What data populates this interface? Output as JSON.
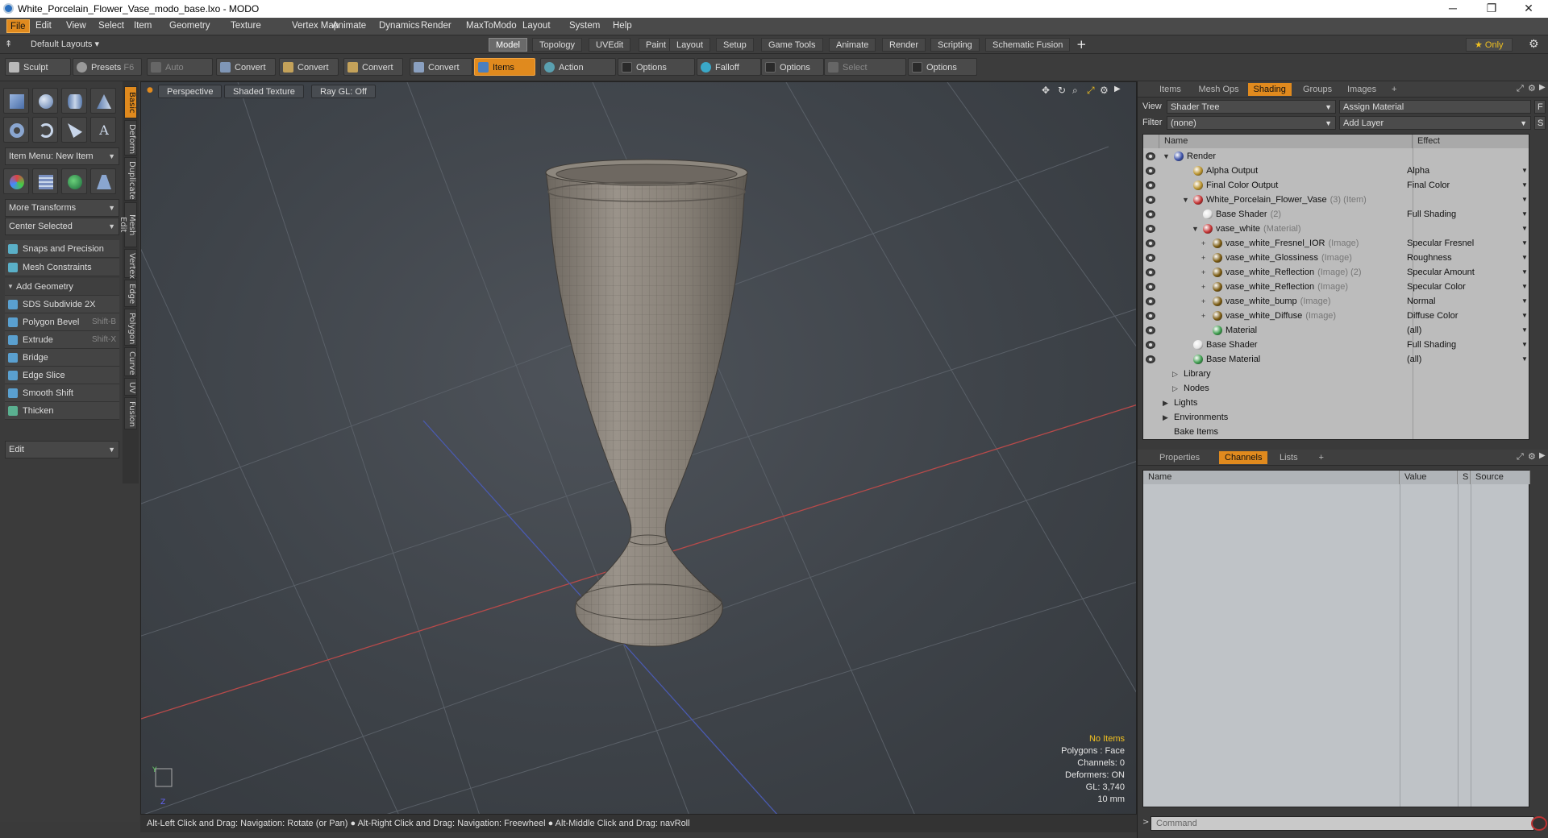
{
  "window": {
    "title": "White_Porcelain_Flower_Vase_modo_base.lxo - MODO",
    "minimize": "─",
    "maximize": "❐",
    "close": "✕"
  },
  "menubar": {
    "items": [
      "File",
      "Edit",
      "View",
      "Select",
      "Item",
      "Geometry",
      "Texture",
      "Vertex Map",
      "Animate",
      "Dynamics",
      "Render",
      "MaxToModo",
      "Layout",
      "System",
      "Help"
    ]
  },
  "layoutbar": {
    "layout_dropdown": "Default Layouts ▾",
    "tabs": [
      "Model",
      "Topology",
      "UVEdit",
      "Paint",
      "Layout",
      "Setup",
      "Game Tools",
      "Animate",
      "Render",
      "Scripting",
      "Schematic Fusion"
    ],
    "active_tab": "Model",
    "add": "+",
    "only_label": "★ Only"
  },
  "toolbar": {
    "sculpt": "Sculpt",
    "presets": "Presets",
    "presets_shortcut": "F6",
    "auto_select": "Auto Select",
    "convert1": "Convert",
    "convert2": "Convert",
    "convert3": "Convert",
    "convert4": "Convert",
    "items": "Items",
    "action_center": "Action Center",
    "options1": "Options",
    "falloff": "Falloff",
    "options2": "Options",
    "select_through": "Select Through",
    "options3": "Options"
  },
  "leftpanel": {
    "item_menu": "Item Menu: New Item",
    "more_transforms": "More Transforms",
    "center_selected": "Center Selected",
    "snaps": "Snaps and Precision",
    "mesh_constraints": "Mesh Constraints",
    "add_geometry": "Add Geometry",
    "tools": [
      {
        "label": "SDS Subdivide 2X",
        "shortcut": ""
      },
      {
        "label": "Polygon Bevel",
        "shortcut": "Shift-B"
      },
      {
        "label": "Extrude",
        "shortcut": "Shift-X"
      },
      {
        "label": "Bridge",
        "shortcut": ""
      },
      {
        "label": "Edge Slice",
        "shortcut": ""
      },
      {
        "label": "Smooth Shift",
        "shortcut": ""
      },
      {
        "label": "Thicken",
        "shortcut": ""
      }
    ],
    "edit_dropdown": "Edit",
    "vtabs": [
      "Basic",
      "Deform",
      "Duplicate",
      "Mesh Edit",
      "Vertex",
      "Edge",
      "Polygon",
      "Curve",
      "UV",
      "Fusion"
    ]
  },
  "viewport": {
    "perspective": "Perspective",
    "shading": "Shaded Texture",
    "raygl": "Ray GL: Off",
    "info": {
      "no_items": "No Items",
      "polygons": "Polygons : Face",
      "channels": "Channels: 0",
      "deformers": "Deformers: ON",
      "gl": "GL: 3,740",
      "scale": "10 mm"
    }
  },
  "statusbar": {
    "text": "Alt-Left Click and Drag: Navigation: Rotate (or Pan) ● Alt-Right Click and Drag: Navigation: Freewheel ● Alt-Middle Click and Drag: navRoll"
  },
  "shading_panel": {
    "tabs": [
      "Items",
      "Mesh Ops",
      "Shading",
      "Groups",
      "Images",
      "+"
    ],
    "active_tab": "Shading",
    "view_label": "View",
    "view_value": "Shader Tree",
    "assign_material": "Assign Material",
    "assign_btn": "F",
    "filter_label": "Filter",
    "filter_value": "(none)",
    "add_layer": "Add Layer",
    "add_btn": "S",
    "col_name": "Name",
    "col_effect": "Effect",
    "rows": [
      {
        "name": "Render",
        "sub": "",
        "effect": "",
        "indent": 0,
        "ball": "#3a4fa8",
        "tog": "▼"
      },
      {
        "name": "Alpha Output",
        "sub": "",
        "effect": "Alpha",
        "indent": 2,
        "ball": "#b8912a",
        "tog": ""
      },
      {
        "name": "Final Color Output",
        "sub": "",
        "effect": "Final Color",
        "indent": 2,
        "ball": "#b8912a",
        "tog": ""
      },
      {
        "name": "White_Porcelain_Flower_Vase",
        "sub": "(3) (Item)",
        "effect": "",
        "indent": 2,
        "ball": "#c23030",
        "tog": "▼"
      },
      {
        "name": "Base Shader",
        "sub": "(2)",
        "effect": "Full Shading",
        "indent": 3,
        "ball": "#e4e4e4",
        "tog": ""
      },
      {
        "name": "vase_white",
        "sub": "(Material)",
        "effect": "",
        "indent": 3,
        "ball": "#c23030",
        "tog": "▼"
      },
      {
        "name": "vase_white_Fresnel_IOR",
        "sub": "(Image)",
        "effect": "Specular Fresnel",
        "indent": 4,
        "ball": "#7a5a10",
        "tog": "+"
      },
      {
        "name": "vase_white_Glossiness",
        "sub": "(Image)",
        "effect": "Roughness",
        "indent": 4,
        "ball": "#7a5a10",
        "tog": "+"
      },
      {
        "name": "vase_white_Reflection",
        "sub": "(Image) (2)",
        "effect": "Specular Amount",
        "indent": 4,
        "ball": "#7a5a10",
        "tog": "+"
      },
      {
        "name": "vase_white_Reflection",
        "sub": "(Image)",
        "effect": "Specular Color",
        "indent": 4,
        "ball": "#7a5a10",
        "tog": "+"
      },
      {
        "name": "vase_white_bump",
        "sub": "(Image)",
        "effect": "Normal",
        "indent": 4,
        "ball": "#7a5a10",
        "tog": "+"
      },
      {
        "name": "vase_white_Diffuse",
        "sub": "(Image)",
        "effect": "Diffuse Color",
        "indent": 4,
        "ball": "#7a5a10",
        "tog": "+"
      },
      {
        "name": "Material",
        "sub": "",
        "effect": "(all)",
        "indent": 4,
        "ball": "#3c9c4c",
        "tog": ""
      },
      {
        "name": "Base Shader",
        "sub": "",
        "effect": "Full Shading",
        "indent": 2,
        "ball": "#e4e4e4",
        "tog": ""
      },
      {
        "name": "Base Material",
        "sub": "",
        "effect": "(all)",
        "indent": 2,
        "ball": "#3c9c4c",
        "tog": ""
      },
      {
        "name": "Library",
        "sub": "",
        "effect": "",
        "indent": 1,
        "ball": "",
        "tog": "▷"
      },
      {
        "name": "Nodes",
        "sub": "",
        "effect": "",
        "indent": 1,
        "ball": "",
        "tog": "▷"
      },
      {
        "name": "Lights",
        "sub": "",
        "effect": "",
        "indent": 0,
        "ball": "",
        "tog": "▶"
      },
      {
        "name": "Environments",
        "sub": "",
        "effect": "",
        "indent": 0,
        "ball": "",
        "tog": "▶"
      },
      {
        "name": "Bake Items",
        "sub": "",
        "effect": "",
        "indent": 0,
        "ball": "",
        "tog": ""
      }
    ]
  },
  "channels_panel": {
    "tabs": [
      "Properties",
      "Channels",
      "Lists",
      "+"
    ],
    "active_tab": "Channels",
    "cols": [
      "Name",
      "Value",
      "S",
      "Source"
    ]
  },
  "command": {
    "placeholder": "Command"
  }
}
